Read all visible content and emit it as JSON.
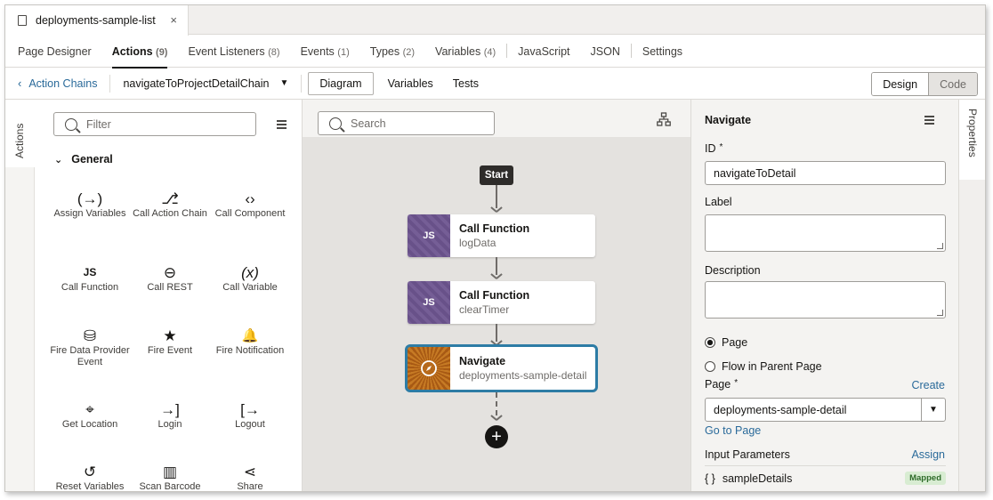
{
  "file_tab": {
    "name": "deployments-sample-list",
    "close": "×"
  },
  "top_tabs": [
    {
      "label": "Page Designer",
      "count": ""
    },
    {
      "label": "Actions",
      "count": "(9)"
    },
    {
      "label": "Event Listeners",
      "count": "(8)"
    },
    {
      "label": "Events",
      "count": "(1)"
    },
    {
      "label": "Types",
      "count": "(2)"
    },
    {
      "label": "Variables",
      "count": "(4)"
    },
    {
      "label": "JavaScript",
      "count": ""
    },
    {
      "label": "JSON",
      "count": ""
    },
    {
      "label": "Settings",
      "count": ""
    }
  ],
  "subheader": {
    "back_label": "Action Chains",
    "chain_name": "navigateToProjectDetailChain",
    "view_tabs": [
      "Diagram",
      "Variables",
      "Tests"
    ],
    "design_label": "Design",
    "code_label": "Code"
  },
  "left_rail": {
    "label": "Actions"
  },
  "palette": {
    "filter_placeholder": "Filter",
    "group": "General",
    "items": [
      {
        "label": "Assign Variables",
        "icon": "(→)"
      },
      {
        "label": "Call Action Chain",
        "icon": "⎇"
      },
      {
        "label": "Call Component",
        "icon": "‹›"
      },
      {
        "label": "Call Function",
        "icon": "JS"
      },
      {
        "label": "Call REST",
        "icon": "⊖"
      },
      {
        "label": "Call Variable",
        "icon": "(x)"
      },
      {
        "label": "Fire Data Provider Event",
        "icon": "⛁"
      },
      {
        "label": "Fire Event",
        "icon": "★"
      },
      {
        "label": "Fire Notification",
        "icon": "🔔"
      },
      {
        "label": "Get Location",
        "icon": "⌖"
      },
      {
        "label": "Login",
        "icon": "→]"
      },
      {
        "label": "Logout",
        "icon": "[→"
      },
      {
        "label": "Reset Variables",
        "icon": "↺"
      },
      {
        "label": "Scan Barcode",
        "icon": "▥"
      },
      {
        "label": "Share",
        "icon": "⋖"
      }
    ]
  },
  "canvas": {
    "search_placeholder": "Search",
    "start_label": "Start",
    "nodes": [
      {
        "title": "Call Function",
        "subtitle": "logData",
        "icon": "JS"
      },
      {
        "title": "Call Function",
        "subtitle": "clearTimer",
        "icon": "JS"
      },
      {
        "title": "Navigate",
        "subtitle": "deployments-sample-detail",
        "icon": "⊘"
      }
    ],
    "add_label": "+"
  },
  "properties": {
    "title": "Navigate",
    "id_label": "ID",
    "id_required": "*",
    "id_value": "navigateToDetail",
    "label_label": "Label",
    "description_label": "Description",
    "radio_page": "Page",
    "radio_parent": "Flow in Parent Page",
    "page_label": "Page",
    "page_required": "*",
    "create_link": "Create",
    "page_value": "deployments-sample-detail",
    "goto_link": "Go to Page",
    "input_params_label": "Input Parameters",
    "assign_link": "Assign",
    "param_brace": "{ }",
    "param_name": "sampleDetails",
    "param_badge": "Mapped",
    "rail_label": "Properties"
  }
}
